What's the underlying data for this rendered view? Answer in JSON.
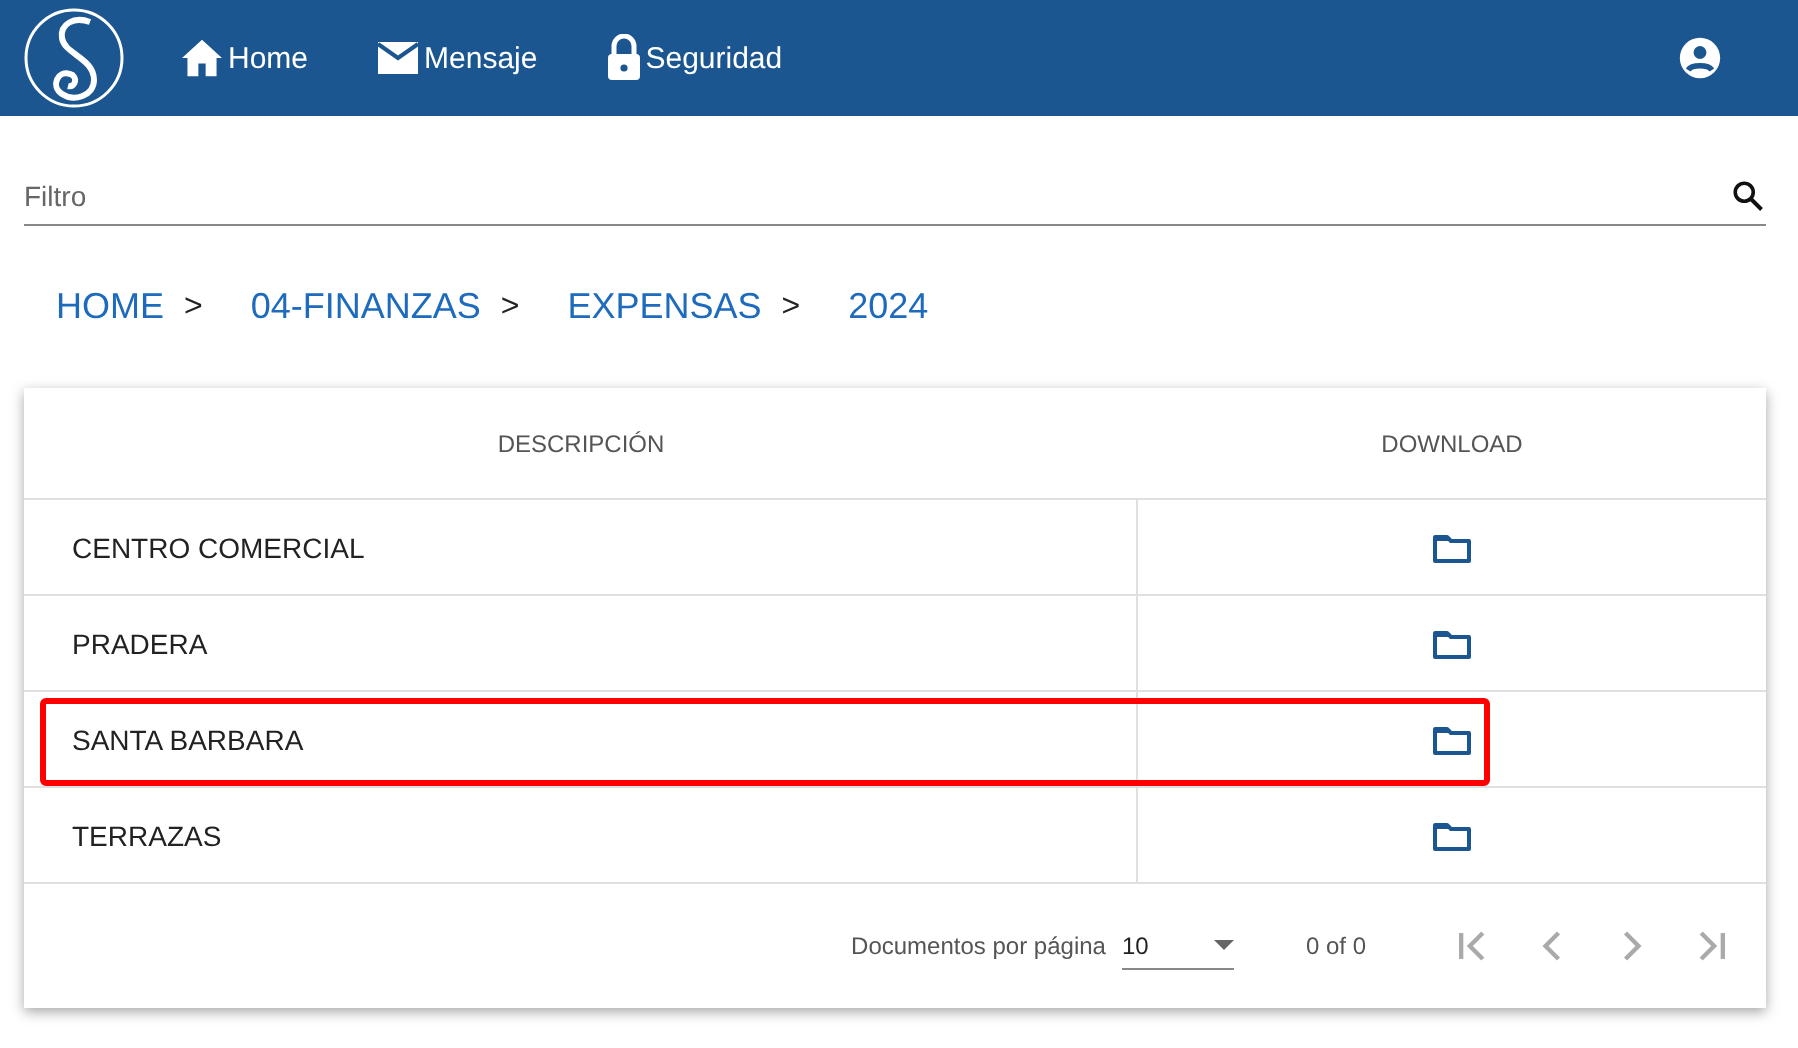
{
  "nav": [
    {
      "kind": "home",
      "label": "Home"
    },
    {
      "kind": "mail",
      "label": "Mensaje"
    },
    {
      "kind": "lock",
      "label": "Seguridad"
    }
  ],
  "filter": {
    "placeholder": "Filtro"
  },
  "breadcrumb": [
    {
      "label": "HOME",
      "separator": ">"
    },
    {
      "label": "04-FINANZAS",
      "separator": ">"
    },
    {
      "label": "EXPENSAS",
      "separator": ">"
    },
    {
      "label": "2024"
    }
  ],
  "table": {
    "columns": [
      "DESCRIPCIÓN",
      "DOWNLOAD"
    ],
    "rows": [
      {
        "description": "CENTRO COMERCIAL",
        "highlighted": false
      },
      {
        "description": "PRADERA",
        "highlighted": false
      },
      {
        "description": "SANTA BARBARA",
        "highlighted": true
      },
      {
        "description": "TERRAZAS",
        "highlighted": false
      }
    ]
  },
  "paginator": {
    "label": "Documentos por página",
    "page_size": "10",
    "range": "0 of 0"
  }
}
